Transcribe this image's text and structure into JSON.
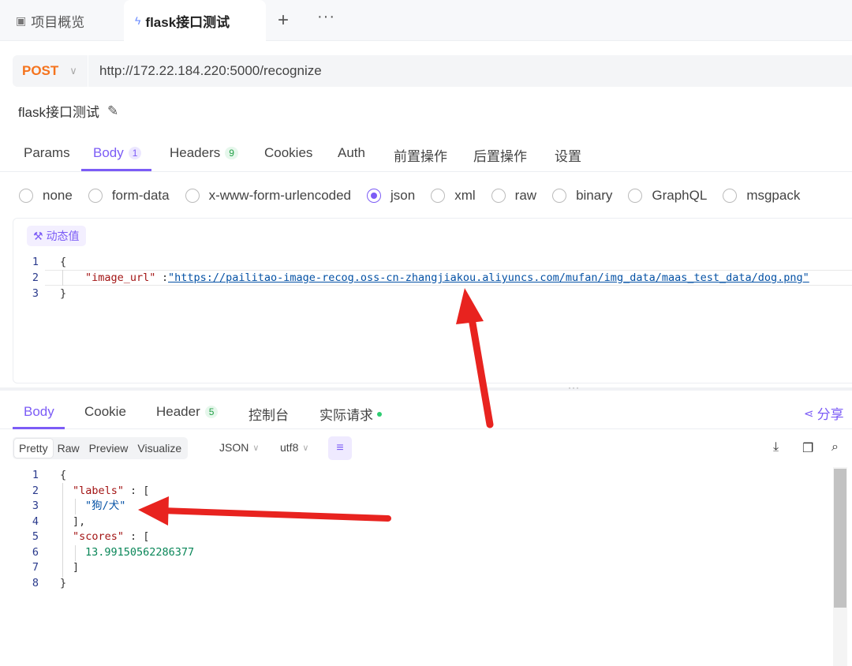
{
  "top_tabs": [
    {
      "icon": "overview-icon",
      "label": "项目概览"
    },
    {
      "icon": "lightning-icon",
      "label": "flask接口测试"
    }
  ],
  "request": {
    "method": "POST",
    "url": "http://172.22.184.220:5000/recognize",
    "name": "flask接口测试",
    "tabs": [
      {
        "label": "Params"
      },
      {
        "label": "Body",
        "count": "1"
      },
      {
        "label": "Headers",
        "count": "9"
      },
      {
        "label": "Cookies"
      },
      {
        "label": "Auth"
      },
      {
        "label": "前置操作"
      },
      {
        "label": "后置操作"
      },
      {
        "label": "设置"
      }
    ],
    "body_types": [
      "none",
      "form-data",
      "x-www-form-urlencoded",
      "json",
      "xml",
      "raw",
      "binary",
      "GraphQL",
      "msgpack"
    ],
    "selected_body_type": "json",
    "dynamic_value_label": "动态值",
    "body_lines": [
      {
        "n": "1",
        "open": "{"
      },
      {
        "n": "2",
        "key": "\"image_url\"",
        "sep": ":",
        "value": "\"https://pailitao-image-recog.oss-cn-zhangjiakou.aliyuncs.com/mufan/img_data/maas_test_data/dog.png\""
      },
      {
        "n": "3",
        "close": "}"
      }
    ]
  },
  "response": {
    "tabs": [
      {
        "label": "Body"
      },
      {
        "label": "Cookie"
      },
      {
        "label": "Header",
        "count": "5"
      },
      {
        "label": "控制台"
      },
      {
        "label": "实际请求"
      }
    ],
    "share_label": "分享",
    "view_modes": [
      "Pretty",
      "Raw",
      "Preview",
      "Visualize"
    ],
    "format": "JSON",
    "encoding": "utf8",
    "lines": [
      {
        "n": "1",
        "text": "{"
      },
      {
        "n": "2",
        "key": "\"labels\"",
        "rest": ": ["
      },
      {
        "n": "3",
        "str": "\"狗/犬\""
      },
      {
        "n": "4",
        "text": "],"
      },
      {
        "n": "5",
        "key": "\"scores\"",
        "rest": ": ["
      },
      {
        "n": "6",
        "num": "13.99150562286377"
      },
      {
        "n": "7",
        "text": "]"
      },
      {
        "n": "8",
        "text": "}"
      }
    ]
  },
  "colors": {
    "accent": "#7c5cf6",
    "method": "#f5731d",
    "arrow": "#e8231f"
  }
}
